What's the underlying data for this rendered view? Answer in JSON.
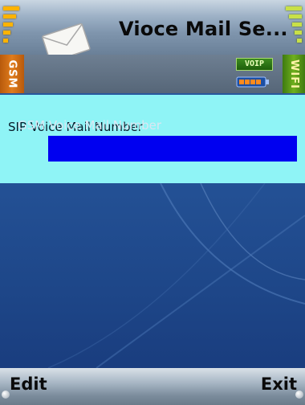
{
  "header": {
    "title": "Vioce Mail Se...",
    "icon": "envelope-icon"
  },
  "status": {
    "gsm_label": "GSM",
    "wifi_label": "WIFI",
    "voip_badge": "VOIP",
    "battery_icon": "battery-icon",
    "gsm_signal_icon": "gsm-signal-bars-icon",
    "wifi_signal_icon": "wifi-signal-bars-icon"
  },
  "form": {
    "sip_voice_mail": {
      "label": "SIP Voice Mail Number",
      "value": ""
    },
    "gsm_voice_mail": {
      "label": "GSM Voice Mail Number",
      "value": ""
    }
  },
  "softkeys": {
    "left": "Edit",
    "right": "Exit"
  },
  "colors": {
    "selected_row": "#8ff4f6",
    "input_fill": "#0000f0",
    "gsm_accent": "#e07c1c",
    "wifi_accent": "#6fb01d",
    "background": "#26559a"
  }
}
